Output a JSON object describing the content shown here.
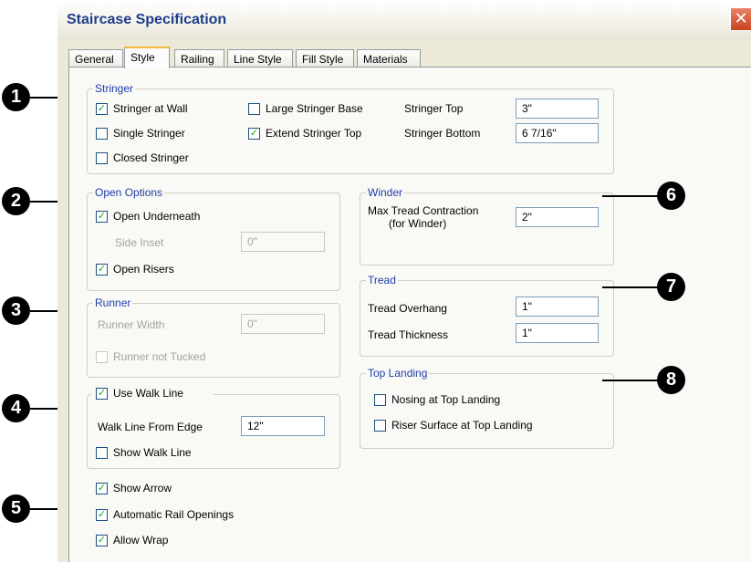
{
  "window": {
    "title": "Staircase Specification",
    "close_glyph": "✕"
  },
  "tabs": [
    "General",
    "Style",
    "Railing",
    "Line Style",
    "Fill Style",
    "Materials"
  ],
  "stringer": {
    "legend": "Stringer",
    "stringer_at_wall": {
      "label": "Stringer at Wall",
      "checked": true
    },
    "single_stringer": {
      "label": "Single Stringer",
      "checked": false
    },
    "closed_stringer": {
      "label": "Closed Stringer",
      "checked": false
    },
    "large_stringer_base": {
      "label": "Large Stringer Base",
      "checked": false
    },
    "extend_stringer_top": {
      "label": "Extend Stringer Top",
      "checked": true
    },
    "top_label": "Stringer Top",
    "top_value": "3\"",
    "bottom_label": "Stringer Bottom",
    "bottom_value": "6 7/16\""
  },
  "open_options": {
    "legend": "Open Options",
    "open_underneath": {
      "label": "Open Underneath",
      "checked": true
    },
    "side_inset_label": "Side Inset",
    "side_inset_value": "0\"",
    "open_risers": {
      "label": "Open Risers",
      "checked": true
    }
  },
  "runner": {
    "legend": "Runner",
    "width_label": "Runner Width",
    "width_value": "0\"",
    "not_tucked": {
      "label": "Runner not Tucked",
      "checked": false
    }
  },
  "walk_line": {
    "use_walk_line": {
      "label": "Use Walk Line",
      "checked": true
    },
    "from_edge_label": "Walk Line From Edge",
    "from_edge_value": "12\"",
    "show_walk_line": {
      "label": "Show Walk Line",
      "checked": false
    }
  },
  "misc": {
    "show_arrow": {
      "label": "Show Arrow",
      "checked": true
    },
    "automatic_rail_openings": {
      "label": "Automatic Rail Openings",
      "checked": true
    },
    "allow_wrap": {
      "label": "Allow Wrap",
      "checked": true
    }
  },
  "winder": {
    "legend": "Winder",
    "contraction_label_1": "Max Tread Contraction",
    "contraction_label_2": "(for Winder)",
    "contraction_value": "2\""
  },
  "tread": {
    "legend": "Tread",
    "overhang_label": "Tread Overhang",
    "overhang_value": "1\"",
    "thickness_label": "Tread Thickness",
    "thickness_value": "1\""
  },
  "top_landing": {
    "legend": "Top Landing",
    "nosing": {
      "label": "Nosing at Top Landing",
      "checked": false
    },
    "riser_surface": {
      "label": "Riser Surface at Top Landing",
      "checked": false
    }
  },
  "callouts": [
    "1",
    "2",
    "3",
    "4",
    "5",
    "6",
    "7",
    "8"
  ],
  "check_glyph": "✓"
}
